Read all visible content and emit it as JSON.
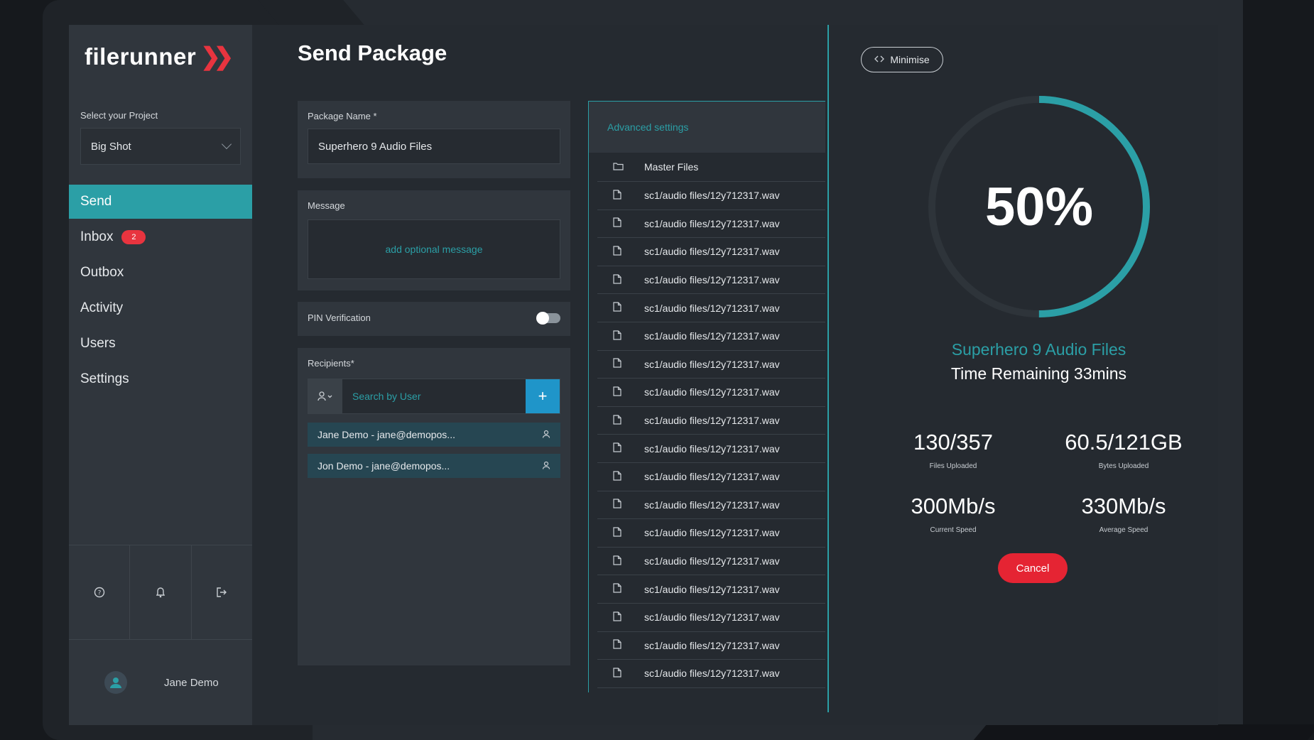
{
  "app": {
    "logo_text": "filerunner",
    "logo_mark": "»",
    "colors": {
      "accent": "#2b9fa6",
      "danger": "#e52433",
      "sidebar": "#30363d",
      "background": "#252a30"
    }
  },
  "sidebar": {
    "project_label": "Select your Project",
    "project_value": "Big Shot",
    "nav": [
      {
        "label": "Send",
        "active": true
      },
      {
        "label": "Inbox",
        "badge": "2"
      },
      {
        "label": "Outbox"
      },
      {
        "label": "Activity"
      },
      {
        "label": "Users"
      },
      {
        "label": "Settings"
      }
    ],
    "bottom_icons": [
      "help-icon",
      "bell-icon",
      "logout-icon"
    ],
    "user_name": "Jane Demo"
  },
  "main": {
    "title": "Send Package",
    "package_name_label": "Package Name *",
    "package_name_value": "Superhero 9 Audio Files",
    "message_label": "Message",
    "message_placeholder": "add optional message",
    "pin_label": "PIN Verification",
    "pin_enabled": false,
    "recipients_label": "Recipients*",
    "search_placeholder": "Search by User",
    "recipients": [
      "Jane Demo - jane@demopos...",
      "Jon Demo - jane@demopos..."
    ]
  },
  "files": {
    "advanced_label": "Advanced settings",
    "folder_name": "Master Files",
    "items": [
      "sc1/audio files/12y712317.wav",
      "sc1/audio files/12y712317.wav",
      "sc1/audio files/12y712317.wav",
      "sc1/audio files/12y712317.wav",
      "sc1/audio files/12y712317.wav",
      "sc1/audio files/12y712317.wav",
      "sc1/audio files/12y712317.wav",
      "sc1/audio files/12y712317.wav",
      "sc1/audio files/12y712317.wav",
      "sc1/audio files/12y712317.wav",
      "sc1/audio files/12y712317.wav",
      "sc1/audio files/12y712317.wav",
      "sc1/audio files/12y712317.wav",
      "sc1/audio files/12y712317.wav",
      "sc1/audio files/12y712317.wav",
      "sc1/audio files/12y712317.wav",
      "sc1/audio files/12y712317.wav",
      "sc1/audio files/12y712317.wav"
    ]
  },
  "upload": {
    "minimise_label": "Minimise",
    "progress_text": "50%",
    "progress": 0.5,
    "package_name": "Superhero 9 Audio Files",
    "time_remaining": "Time Remaining  33mins",
    "stats": [
      {
        "value": "130/357",
        "label": "Files Uploaded"
      },
      {
        "value": "60.5/121GB",
        "label": "Bytes Uploaded"
      },
      {
        "value": "300Mb/s",
        "label": "Current Speed"
      },
      {
        "value": "330Mb/s",
        "label": "Average Speed"
      }
    ],
    "cancel_label": "Cancel"
  }
}
